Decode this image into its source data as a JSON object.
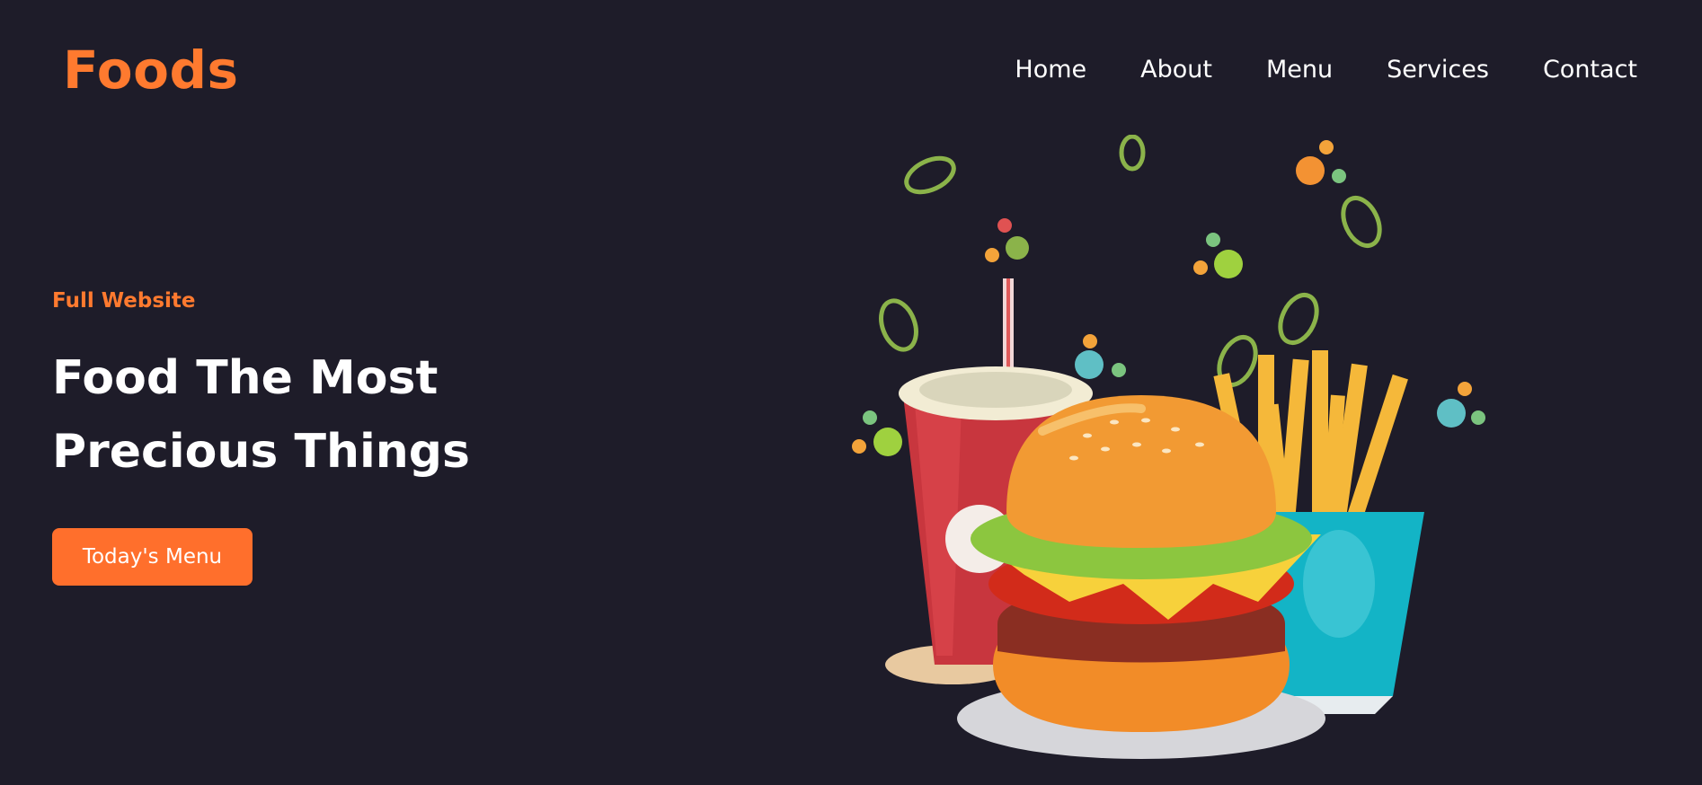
{
  "header": {
    "logo": "Foods",
    "nav": [
      "Home",
      "About",
      "Menu",
      "Services",
      "Contact"
    ]
  },
  "hero": {
    "eyebrow": "Full Website",
    "title_line1": "Food The Most",
    "title_line2": "Precious Things",
    "cta_label": "Today's Menu",
    "illustration": "burger-fries-drink-illustration"
  },
  "colors": {
    "background": "#1e1c29",
    "accent": "#ff7a2f",
    "text": "#ffffff"
  }
}
